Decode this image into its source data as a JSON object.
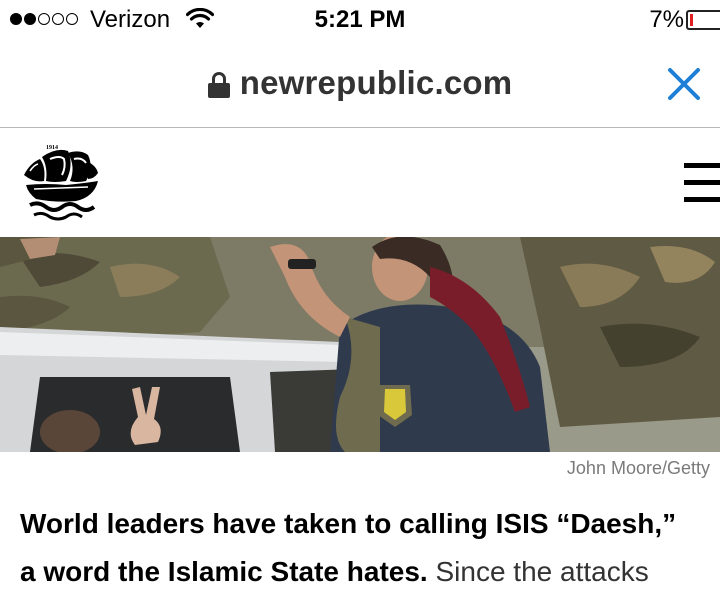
{
  "status_bar": {
    "signal_bars": 2,
    "signal_total": 5,
    "carrier": "Verizon",
    "time": "5:21 PM",
    "battery_percent": "7%",
    "battery_level": 0.07,
    "battery_color": "#e02020",
    "icons": [
      "signal-dots",
      "wifi-icon",
      "battery-icon"
    ]
  },
  "browser": {
    "domain": "newrepublic.com",
    "lock_icon": "lock-icon",
    "close_icon": "close-icon",
    "close_color": "#1e7fd6"
  },
  "site": {
    "logo_icon": "ship-logo-icon",
    "logo_year": "1914",
    "menu_icon": "hamburger-menu-icon"
  },
  "hero": {
    "image": "soldiers-in-vehicle-photo",
    "caption": "John Moore/Getty"
  },
  "article": {
    "line1_bold": "World leaders have taken to calling ISIS “Daesh,”",
    "line2_bold": "a word the Islamic State hates.",
    "line2_body": "Since the attacks"
  }
}
